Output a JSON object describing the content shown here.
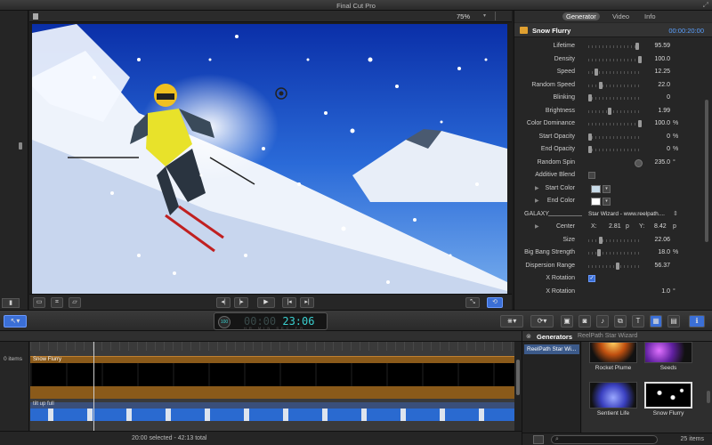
{
  "window": {
    "title": "Final Cut Pro"
  },
  "viewer": {
    "zoom": "75%"
  },
  "inspector": {
    "tabs": [
      "Generator",
      "Video",
      "Info"
    ],
    "generator_name": "Snow Flurry",
    "timecode": "00:00:20:00",
    "params": [
      {
        "label": "Lifetime",
        "value": "95.59",
        "unit": "",
        "knob": 0.95
      },
      {
        "label": "Density",
        "value": "100.0",
        "unit": "",
        "knob": 1.0
      },
      {
        "label": "Speed",
        "value": "12.25",
        "unit": "",
        "knob": 0.12
      },
      {
        "label": "Random Speed",
        "value": "22.0",
        "unit": "",
        "knob": 0.22
      },
      {
        "label": "Blinking",
        "value": "0",
        "unit": "",
        "knob": 0.0
      },
      {
        "label": "Brightness",
        "value": "1.99",
        "unit": "",
        "knob": 0.4
      },
      {
        "label": "Color Dominance",
        "value": "100.0",
        "unit": "%",
        "knob": 1.0
      },
      {
        "label": "Start Opacity",
        "value": "0",
        "unit": "%",
        "knob": 0.0
      },
      {
        "label": "End Opacity",
        "value": "0",
        "unit": "%",
        "knob": 0.0
      },
      {
        "label": "Random Spin",
        "value": "235.0",
        "unit": "°"
      },
      {
        "label": "Additive Blend"
      },
      {
        "label": "Start Color"
      },
      {
        "label": "End Color"
      },
      {
        "label": "GALAXY",
        "value": "Star Wizard - www.reelpath...."
      },
      {
        "label": "Center",
        "x": "2.81",
        "y": "8.42",
        "unit": "p"
      },
      {
        "label": "Size",
        "value": "22.06",
        "unit": "",
        "knob": 0.22
      },
      {
        "label": "Big Bang Strength",
        "value": "18.0",
        "unit": "%",
        "knob": 0.18
      },
      {
        "label": "Dispersion Range",
        "value": "56.37",
        "unit": "",
        "knob": 0.56
      },
      {
        "label": "X Rotation"
      },
      {
        "label": "X Rotation",
        "value": "1.0",
        "unit": "°"
      }
    ],
    "center_x_label": "X:",
    "center_y_label": "Y:"
  },
  "toolbar": {
    "timecode": "23:06",
    "timecode_dim": "00:00",
    "percent": "100"
  },
  "timeline": {
    "left_label": "0 items",
    "clip1": "Snow Flurry",
    "clip2": "tilt up full"
  },
  "status": {
    "text": "20:00 selected - 42:13 total"
  },
  "browser": {
    "title": "Generators",
    "subtitle": "ReelPath Star Wizard",
    "list_selected": "ReelPath Star Wi...",
    "items": [
      "Rocket Plume",
      "Seeds",
      "Sentient Life",
      "Snow Flurry"
    ],
    "count": "25 items"
  },
  "colors": {
    "accent": "#3b6fd6",
    "timecode": "#3ad0d0",
    "clip": "#8a5a1a"
  }
}
